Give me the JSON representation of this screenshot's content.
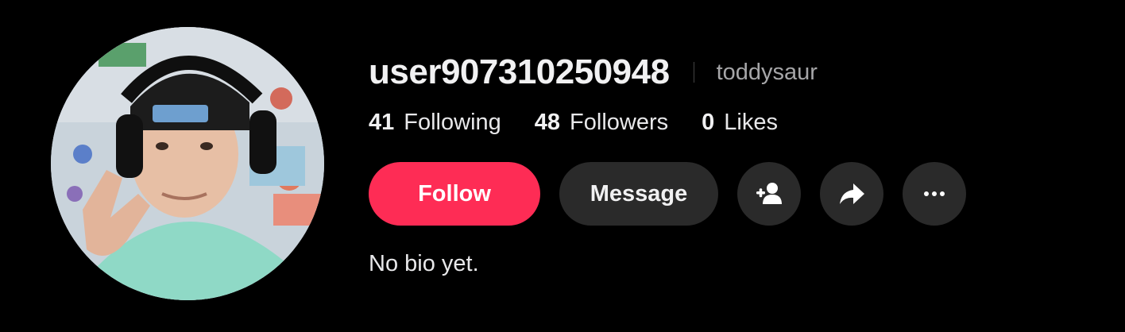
{
  "profile": {
    "username": "user907310250948",
    "nickname": "toddysaur",
    "bio": "No bio yet."
  },
  "stats": {
    "following": {
      "count": "41",
      "label": "Following"
    },
    "followers": {
      "count": "48",
      "label": "Followers"
    },
    "likes": {
      "count": "0",
      "label": "Likes"
    }
  },
  "actions": {
    "follow_label": "Follow",
    "message_label": "Message",
    "add_friend_icon": "add-friend-icon",
    "share_icon": "share-icon",
    "more_icon": "more-icon"
  },
  "colors": {
    "background": "#000000",
    "accent": "#fe2c55",
    "button_secondary": "#2a2a2a"
  }
}
